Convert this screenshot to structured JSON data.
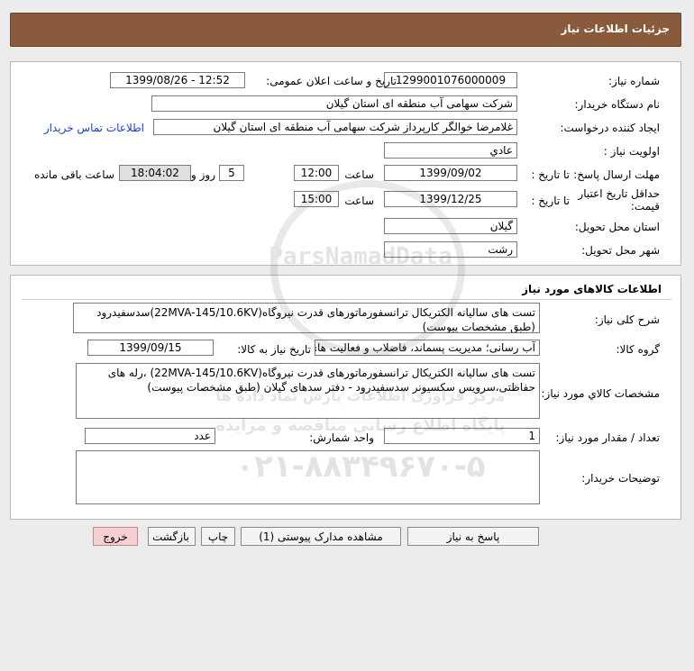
{
  "header": {
    "title": "جزئیات اطلاعات نیاز"
  },
  "info": {
    "need_number_label": "شماره نیاز:",
    "need_number": "1299001076000009",
    "announce_label": "تاریخ و ساعت اعلان عمومی:",
    "announce_value": "1399/08/26 - 12:52",
    "buyer_org_label": "نام دستگاه خریدار:",
    "buyer_org": "شرکت سهامی آب منطقه ای استان گیلان",
    "requester_label": "ایجاد کننده درخواست:",
    "requester": "غلامرضا خوالگر کارپرداز شرکت سهامی آب منطقه ای استان گیلان",
    "contact_link": "اطلاعات تماس خریدار",
    "priority_label": "اولویت نیاز :",
    "priority": "عادي",
    "deadline_label": "مهلت ارسال پاسخ:",
    "to_date_label": "تا تاریخ :",
    "deadline_date": "1399/09/02",
    "time_label": "ساعت",
    "deadline_time": "12:00",
    "days_value": "5",
    "days_label": "روز و",
    "remaining_time": "18:04:02",
    "remaining_label": "ساعت باقی مانده",
    "validity_label": "حداقل تاریخ اعتبار قیمت:",
    "validity_date": "1399/12/25",
    "validity_time": "15:00",
    "province_label": "استان محل تحویل:",
    "province": "گیلان",
    "city_label": "شهر محل تحویل:",
    "city": "رشت"
  },
  "goods": {
    "section_title": "اطلاعات کالاهای مورد نیاز",
    "general_desc_label": "شرح کلی نیاز:",
    "general_desc": "تست های سالیانه الکتریکال ترانسفورماتورهای قدرت نیروگاه(22MVA-145/10.6KV)سدسفیدرود (طبق مشخصات پیوست)",
    "group_label": "گروه کالا:",
    "group_value": "آب رسانی؛ مدیریت پسماند، فاضلاب و فعالیت های",
    "need_date_label": "تاریخ نیاز به کالا:",
    "need_date": "1399/09/15",
    "specs_label": "مشخصات کالاي مورد نياز:",
    "specs": "تست های سالیانه الکتریکال ترانسفورماتورهای قدرت نیروگاه(22MVA-145/10.6KV) ،رله های حفاظتی،سرویس سکسیونر سدسفیدرود - دفتر سدهای گیلان (طبق مشخصات پیوست)",
    "qty_label": "تعداد / مقدار مورد نیاز:",
    "qty": "1",
    "unit_label": "واحد شمارش:",
    "unit": "عدد",
    "buyer_notes_label": "توضیحات خریدار:",
    "buyer_notes": ""
  },
  "buttons": {
    "reply": "پاسخ به نیاز",
    "attachments": "مشاهده مدارک پیوستی (1)",
    "print": "چاپ",
    "back": "بازگشت",
    "exit": "خروج"
  },
  "watermark": {
    "line1": "مرکز فراوری اطلاعات پارس نماد داده ها",
    "line2": "پایگاه اطلاع رسانی مناقصه و مزایده",
    "phone": "۰۲۱-۸۸۳۴۹۶۷۰-۵",
    "brand": "ParsNamadData"
  }
}
